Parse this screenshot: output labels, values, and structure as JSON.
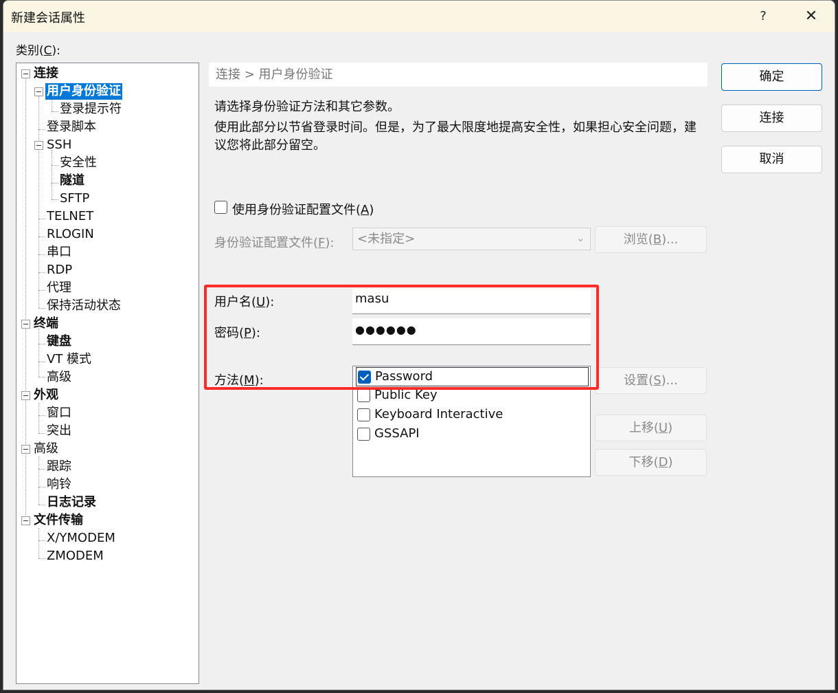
{
  "window": {
    "title": "新建会话属性",
    "help": "?",
    "close": "✕"
  },
  "category": {
    "label": "类别",
    "accel": "C"
  },
  "tree": {
    "connection": "连接",
    "user_auth": "用户身份验证",
    "login_prompt": "登录提示符",
    "login_script": "登录脚本",
    "ssh": "SSH",
    "security": "安全性",
    "tunnel": "隧道",
    "sftp": "SFTP",
    "telnet": "TELNET",
    "rlogin": "RLOGIN",
    "serial": "串口",
    "rdp": "RDP",
    "proxy": "代理",
    "keepalive": "保持活动状态",
    "terminal": "终端",
    "keyboard": "键盘",
    "vt_mode": "VT 模式",
    "term_advanced": "高级",
    "appearance": "外观",
    "window": "窗口",
    "highlight": "突出",
    "advanced": "高级",
    "trace": "跟踪",
    "bell": "响铃",
    "logging": "日志记录",
    "file_transfer": "文件传输",
    "xymodem": "X/YMODEM",
    "zmodem": "ZMODEM"
  },
  "breadcrumb": "连接 > 用户身份验证",
  "description": {
    "line1": "请选择身份验证方法和其它参数。",
    "line2": "使用此部分以节省登录时间。但是，为了最大限度地提高安全性，如果担心安全问题，建议您将此部分留空。"
  },
  "profile": {
    "use_label": "使用身份验证配置文件",
    "use_accel": "A",
    "use_checked": false,
    "file_label": "身份验证配置文件",
    "file_accel": "F",
    "file_value": "<未指定>",
    "browse_label": "浏览",
    "browse_accel": "B"
  },
  "username": {
    "label": "用户名",
    "accel": "U",
    "value": "masu"
  },
  "password": {
    "label": "密码",
    "accel": "P",
    "masked": "●●●●●●"
  },
  "method": {
    "label": "方法",
    "accel": "M",
    "items": [
      {
        "label": "Password",
        "checked": true
      },
      {
        "label": "Public Key",
        "checked": false
      },
      {
        "label": "Keyboard Interactive",
        "checked": false
      },
      {
        "label": "GSSAPI",
        "checked": false
      }
    ],
    "settings_label": "设置",
    "settings_accel": "S",
    "up_label": "上移",
    "up_accel": "U",
    "down_label": "下移",
    "down_accel": "D"
  },
  "buttons": {
    "ok": "确定",
    "connect": "连接",
    "cancel": "取消"
  },
  "colors": {
    "highlight_box": "#ff2a2a",
    "selection": "#0078d7",
    "accent": "#005fb8"
  }
}
